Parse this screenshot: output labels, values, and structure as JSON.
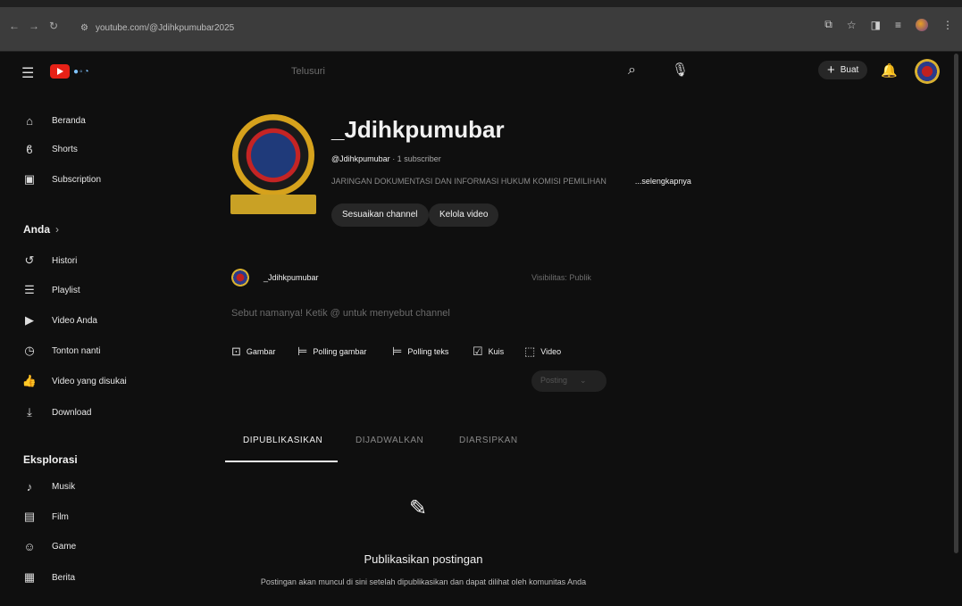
{
  "browser": {
    "url": "youtube.com/@Jdihkpumubar2025"
  },
  "header": {
    "search_placeholder": "Telusuri",
    "create_label": "Buat"
  },
  "sidebar": {
    "main_items": [
      {
        "label": "Beranda",
        "icon": "home-icon"
      },
      {
        "label": "Shorts",
        "icon": "shorts-icon"
      },
      {
        "label": "Subscription",
        "icon": "subscriptions-icon"
      }
    ],
    "you_heading": "Anda",
    "you_items": [
      {
        "label": "Histori",
        "icon": "history-icon"
      },
      {
        "label": "Playlist",
        "icon": "playlist-icon"
      },
      {
        "label": "Video Anda",
        "icon": "your-videos-icon"
      },
      {
        "label": "Tonton nanti",
        "icon": "watch-later-icon"
      },
      {
        "label": "Video yang disukai",
        "icon": "liked-icon"
      },
      {
        "label": "Download",
        "icon": "download-icon"
      }
    ],
    "explore_heading": "Eksplorasi",
    "explore_items": [
      {
        "label": "Musik",
        "icon": "music-icon"
      },
      {
        "label": "Film",
        "icon": "film-icon"
      },
      {
        "label": "Game",
        "icon": "game-icon"
      },
      {
        "label": "Berita",
        "icon": "news-icon"
      }
    ]
  },
  "channel": {
    "name": "_Jdihkpumubar",
    "handle": "@Jdihkpumubar",
    "subscribers": "· 1 subscriber",
    "description": "JARINGAN DOKUMENTASI DAN INFORMASI HUKUM KOMISI PEMILIHAN",
    "more_label": "...selengkapnya",
    "customize_label": "Sesuaikan channel",
    "manage_label": "Kelola video"
  },
  "composer": {
    "author": "_Jdihkpumubar",
    "visibility": "Visibilitas: Publik",
    "placeholder": "Sebut namanya! Ketik @ untuk menyebut channel",
    "tools": [
      {
        "label": "Gambar",
        "icon": "image-icon"
      },
      {
        "label": "Polling gambar",
        "icon": "image-poll-icon"
      },
      {
        "label": "Polling teks",
        "icon": "text-poll-icon"
      },
      {
        "label": "Kuis",
        "icon": "quiz-icon"
      },
      {
        "label": "Video",
        "icon": "video-icon"
      }
    ],
    "post_label": "Posting"
  },
  "tabs": [
    "DIPUBLIKASIKAN",
    "DIJADWALKAN",
    "DIARSIPKAN"
  ],
  "empty_state": {
    "title": "Publikasikan postingan",
    "subtitle": "Postingan akan muncul di sini setelah dipublikasikan dan dapat dilihat oleh komunitas Anda"
  }
}
